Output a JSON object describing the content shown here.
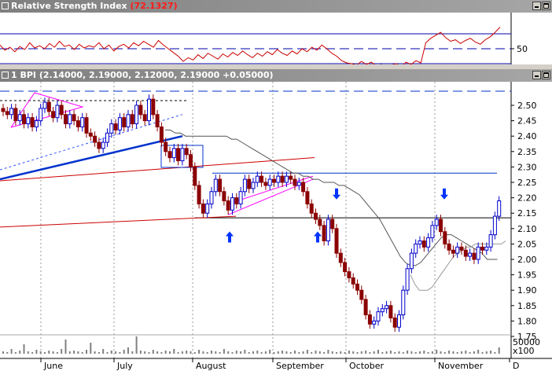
{
  "windows": {
    "rsi": {
      "title": "Relative Strength Index",
      "value": "(72.1327)"
    },
    "price": {
      "title": "1 BPI",
      "value": "(2.14000, 2.19000, 2.12000, 2.19000 +0.05000)"
    }
  },
  "colors": {
    "up_fill": "#ffffff",
    "up_edge": "#0000cc",
    "down": "#8b0000",
    "rsi": "#cc0000",
    "trend_blue": "#0033cc",
    "trend_red": "#cc0000",
    "trend_magenta": "#ff00ff",
    "ma": "#808080",
    "volume": "#808080",
    "arrow": "#0033ff"
  },
  "chart_data": [
    {
      "type": "line",
      "title": "Relative Strength Index",
      "current_value": 72.1327,
      "y_ticks": [
        50
      ],
      "reference_levels": [
        30,
        50,
        70
      ],
      "series": [
        {
          "values": [
            55,
            48,
            52,
            46,
            53,
            49,
            58,
            51,
            54,
            50,
            57,
            52,
            60,
            53,
            55,
            49,
            56,
            51,
            54,
            52,
            58,
            50,
            55,
            47,
            53,
            56,
            51,
            58,
            54,
            60,
            56,
            52,
            61,
            55,
            50,
            45,
            40,
            33,
            38,
            35,
            42,
            37,
            44,
            40,
            36,
            43,
            39,
            45,
            41,
            47,
            42,
            38,
            44,
            40,
            46,
            42,
            49,
            44,
            41,
            47,
            43,
            50,
            46,
            52,
            48,
            55,
            50,
            44,
            40,
            34,
            31,
            30,
            28,
            33,
            29,
            32,
            27,
            29,
            25,
            28,
            30,
            26,
            32,
            29,
            34,
            31,
            58,
            64,
            68,
            72,
            65,
            60,
            62,
            57,
            61,
            64,
            59,
            56,
            62,
            66,
            72,
            79
          ]
        }
      ]
    },
    {
      "type": "candlestick",
      "title": "1 BPI",
      "ohlc_latest": {
        "open": 2.14,
        "high": 2.19,
        "low": 2.12,
        "close": 2.19,
        "change": 0.05
      },
      "ylim": [
        1.72,
        2.55
      ],
      "y_ticks": [
        "2.50",
        "2.45",
        "2.40",
        "2.35",
        "2.30",
        "2.25",
        "2.20",
        "2.15",
        "2.10",
        "2.05",
        "2.00",
        "1.95",
        "1.90",
        "1.85",
        "1.80",
        "1.75"
      ],
      "x_ticks": [
        "June",
        "July",
        "August",
        "September",
        "October",
        "November",
        "D"
      ],
      "closes": [
        2.48,
        2.47,
        2.49,
        2.45,
        2.47,
        2.44,
        2.46,
        2.43,
        2.45,
        2.49,
        2.51,
        2.48,
        2.46,
        2.5,
        2.47,
        2.44,
        2.47,
        2.45,
        2.43,
        2.46,
        2.41,
        2.4,
        2.38,
        2.36,
        2.38,
        2.41,
        2.44,
        2.42,
        2.46,
        2.43,
        2.47,
        2.44,
        2.5,
        2.47,
        2.45,
        2.52,
        2.47,
        2.43,
        2.38,
        2.35,
        2.33,
        2.36,
        2.32,
        2.36,
        2.34,
        2.3,
        2.24,
        2.18,
        2.15,
        2.18,
        2.22,
        2.26,
        2.22,
        2.19,
        2.16,
        2.2,
        2.18,
        2.22,
        2.26,
        2.23,
        2.25,
        2.27,
        2.25,
        2.24,
        2.26,
        2.25,
        2.27,
        2.25,
        2.27,
        2.26,
        2.24,
        2.25,
        2.22,
        2.18,
        2.15,
        2.13,
        2.11,
        2.06,
        2.13,
        2.1,
        2.02,
        1.99,
        1.96,
        1.94,
        1.92,
        1.9,
        1.87,
        1.82,
        1.79,
        1.8,
        1.83,
        1.84,
        1.85,
        1.81,
        1.78,
        1.82,
        1.9,
        1.97,
        2.02,
        2.05,
        2.06,
        2.04,
        2.07,
        2.11,
        2.13,
        2.09,
        2.05,
        2.03,
        2.02,
        2.04,
        2.03,
        2.01,
        2.02,
        2.0,
        2.04,
        2.03,
        2.04,
        2.08,
        2.14,
        2.19
      ],
      "moving_average_1": [
        2.42,
        2.42,
        2.41,
        2.41,
        2.4,
        2.4,
        2.4,
        2.4,
        2.4,
        2.4,
        2.4,
        2.4,
        2.4,
        2.39,
        2.39,
        2.38,
        2.37,
        2.36,
        2.35,
        2.34,
        2.33,
        2.32,
        2.31,
        2.3,
        2.29,
        2.28,
        2.28,
        2.27,
        2.27,
        2.26,
        2.26,
        2.25,
        2.25,
        2.25,
        2.24,
        2.24,
        2.23,
        2.22,
        2.21,
        2.19,
        2.17,
        2.15,
        2.13,
        2.1,
        2.07,
        2.04,
        2.01,
        1.99,
        1.98,
        1.98,
        1.99,
        2.01,
        2.03,
        2.05,
        2.07,
        2.08,
        2.08,
        2.07,
        2.06,
        2.05,
        2.04,
        2.03,
        2.02,
        2.0,
        2.0,
        2.0
      ],
      "moving_average_2": [
        1.95,
        1.92,
        1.9,
        1.9,
        1.9,
        1.91,
        1.93,
        1.95,
        1.97,
        1.99,
        2.01,
        2.02,
        2.03,
        2.04,
        2.04,
        2.05,
        2.05,
        2.05,
        2.05,
        2.05,
        2.05,
        2.05,
        2.06
      ],
      "volume_axis_labels": [
        "50000",
        "x100"
      ]
    }
  ]
}
